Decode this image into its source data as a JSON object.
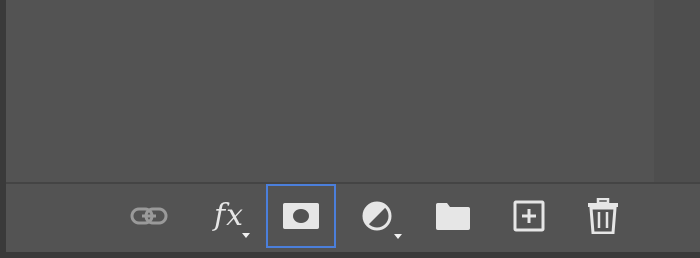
{
  "layers_panel": {
    "toolbar": {
      "buttons": [
        {
          "id": "link-layers",
          "icon": "link-icon",
          "enabled": false
        },
        {
          "id": "layer-style",
          "icon": "fx-icon",
          "label": "fx",
          "has_menu": true
        },
        {
          "id": "add-mask",
          "icon": "mask-icon",
          "selected": true
        },
        {
          "id": "adjustment-layer",
          "icon": "adjustment-circle-icon",
          "has_menu": true
        },
        {
          "id": "new-group",
          "icon": "folder-icon"
        },
        {
          "id": "new-layer",
          "icon": "new-layer-icon"
        },
        {
          "id": "delete-layer",
          "icon": "trash-icon"
        }
      ]
    },
    "colors": {
      "panel_bg": "#535353",
      "icon": "#e6e6e6",
      "icon_disabled": "#9a9a9a",
      "selection_border": "#4b7fdb"
    }
  }
}
